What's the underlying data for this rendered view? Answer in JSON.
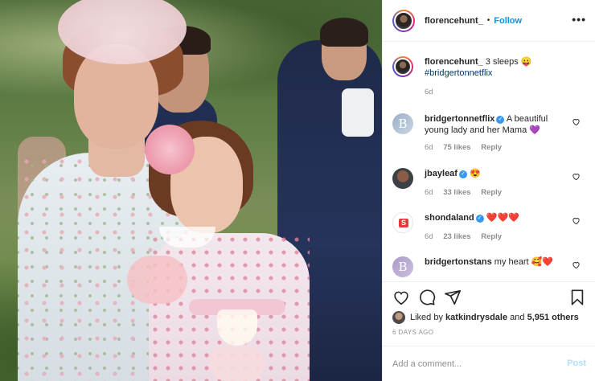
{
  "post": {
    "username": "florencehunt_",
    "separator": "•",
    "follow_label": "Follow",
    "more_label": "•••"
  },
  "caption": {
    "username": "florencehunt_",
    "text": "3 sleeps",
    "emoji": "😛",
    "hashtag": "#bridgertonnetflix",
    "age": "6d"
  },
  "comments": [
    {
      "username": "bridgertonnetflix",
      "verified": true,
      "text": "A beautiful young lady and her Mama",
      "emoji": "💜",
      "age": "6d",
      "likes": "75 likes",
      "reply": "Reply",
      "avatar_letter": "B"
    },
    {
      "username": "jbayleaf",
      "verified": true,
      "text": "",
      "emoji": "😍",
      "age": "6d",
      "likes": "33 likes",
      "reply": "Reply"
    },
    {
      "username": "shondaland",
      "verified": true,
      "text": "",
      "emoji": "❤️❤️❤️",
      "age": "6d",
      "likes": "23 likes",
      "reply": "Reply",
      "avatar_letter": "S"
    },
    {
      "username": "bridgertonstans",
      "verified": false,
      "text": "my heart",
      "emoji": "🥰❤️",
      "avatar_letter": "B"
    }
  ],
  "likes": {
    "prefix": "Liked by",
    "first_user": "katkindrysdale",
    "connector": "and",
    "others": "5,951 others"
  },
  "date": "6 DAYS AGO",
  "add_comment": {
    "placeholder": "Add a comment...",
    "post_label": "Post"
  },
  "icons": [
    "heart-icon",
    "comment-icon",
    "share-icon",
    "bookmark-icon",
    "more-icon",
    "verified-icon"
  ],
  "colors": {
    "follow_blue": "#0095f6",
    "verified_blue": "#3897f0",
    "post_disabled": "#b2dffc",
    "meta_gray": "#8e8e8e"
  }
}
